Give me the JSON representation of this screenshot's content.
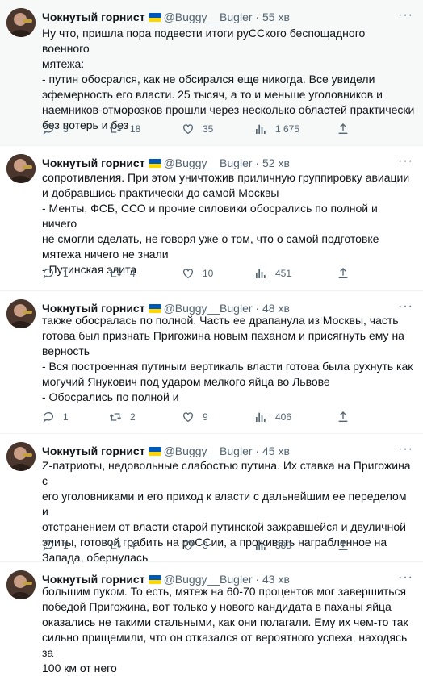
{
  "tweets": [
    {
      "author": "Чокнутый горнист",
      "handle": "@Buggy__Bugler",
      "dot": "·",
      "time": "55 хв",
      "text": "Ну что, пришла пора подвести итоги руССкого беспощадного военного\nмятежа:\n- путин обосрался, как не обсирался еще никогда. Все увидели\nэфемерность его власти. 25 тысяч, а то и меньше уголовников и\nнаемников-отморозков прошли через несколько областей практически\nбез потерь и без",
      "replies": "3",
      "retweets": "18",
      "likes": "35",
      "views": "1 675"
    },
    {
      "author": "Чокнутый горнист",
      "handle": "@Buggy__Bugler",
      "dot": "·",
      "time": "52 хв",
      "text": "сопротивления. При этом уничтожив приличную группировку авиации\nи добравшись практически до самой Москвы\n- Менты, ФСБ, ССО и прочие силовики обосрались по полной и ничего\nне смогли сделать, не говоря уже о том, что о самой подготовке\nмятежа ничего не знали\n- Путинская элита",
      "replies": "1",
      "retweets": "4",
      "likes": "10",
      "views": "451"
    },
    {
      "author": "Чокнутый горнист",
      "handle": "@Buggy__Bugler",
      "dot": "·",
      "time": "48 хв",
      "text": "также обосралась по полной. Часть ее драпанула из Москвы, часть\nготова был признать Пригожина новым паханом и присягнуть ему на\nверность\n- Вся построенная путиным вертикаль власти готова была рухнуть как\nмогучий Янукович под ударом мелкого яйца во Львове\n- Обосрались по полной и",
      "replies": "1",
      "retweets": "2",
      "likes": "9",
      "views": "406"
    },
    {
      "author": "Чокнутый горнист",
      "handle": "@Buggy__Bugler",
      "dot": "·",
      "time": "45 хв",
      "text": "Z-патриоты, недовольные слабостью путина. Их ставка на Пригожина с\nего уголовниками и его приход к власти с дальнейшим ее переделом и\nотстранением от власти старой путинской зажравшейся и двуличной\nэлиты, готовой грабить на роССии, а проживать награбленное на\nЗапада, обернулась",
      "replies": "1",
      "retweets": "4",
      "likes": "3",
      "views": "388"
    },
    {
      "author": "Чокнутый горнист",
      "handle": "@Buggy__Bugler",
      "dot": "·",
      "time": "43 хв",
      "text": "большим пуком. То есть, мятеж на 60-70 процентов мог завершиться\nпобедой Пригожина, вот только у нового кандидата в  паханы яйца\nоказались не такими стальными, как они полагали. Ему их чем-то так\nсильно прищемили, что он отказался от вероятного успеха, находясь за\n100 км от него"
    }
  ],
  "colors": {
    "text": "#0f1419",
    "muted": "#536471",
    "flag_blue": "#0057b7",
    "flag_yellow": "#ffd700",
    "highlight_bg": "#f7f9f9"
  },
  "icons": {
    "reply": "speech-bubble-icon",
    "retweet": "retweet-arrows-icon",
    "like": "heart-icon",
    "views": "bar-chart-icon",
    "share": "share-upload-icon",
    "more": "more-dots-icon",
    "verified_flag": "ukraine-flag-icon"
  }
}
